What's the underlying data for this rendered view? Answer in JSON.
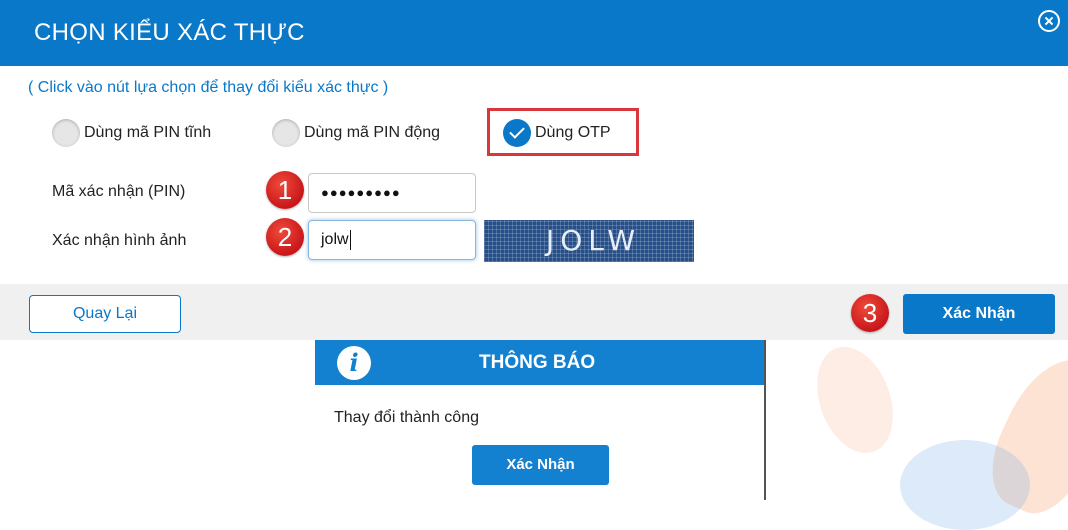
{
  "dialog": {
    "title": "CHỌN KIỂU XÁC THỰC",
    "hint": "( Click vào nút lựa chọn để thay đổi kiểu xác thực )",
    "options": [
      {
        "label": "Dùng mã PIN tĩnh",
        "checked": false
      },
      {
        "label": "Dùng mã PIN động",
        "checked": false
      },
      {
        "label": "Dùng OTP",
        "checked": true
      }
    ],
    "pin_label": "Mã xác nhận (PIN)",
    "pin_value": "●●●●●●●●●",
    "captcha_label": "Xác nhận hình ảnh",
    "captcha_input": "jolw",
    "captcha_image_text": "JOLW",
    "back_label": "Quay Lại",
    "confirm_label": "Xác Nhận"
  },
  "badges": [
    "1",
    "2",
    "3"
  ],
  "notice": {
    "icon": "info-icon",
    "icon_glyph": "i",
    "title": "THÔNG BÁO",
    "message": "Thay đổi thành công",
    "button_label": "Xác Nhận"
  },
  "colors": {
    "primary": "#0a78c8",
    "highlight_border": "#d9373b",
    "badge": "#d7191c"
  }
}
